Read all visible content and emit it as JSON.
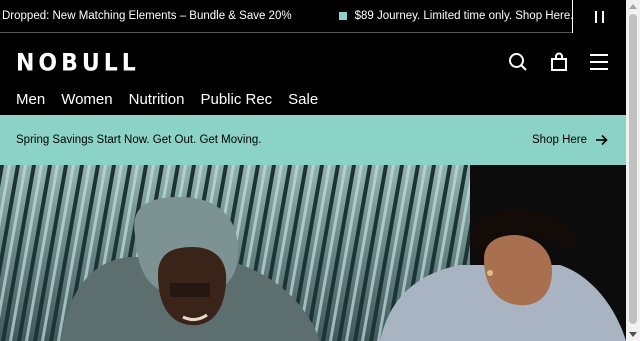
{
  "announcement": {
    "message_1": "Dropped: New Matching Elements – Bundle & Save 20%",
    "message_2": "$89 Journey. Limited time only. Shop Here.",
    "pause_icon": "pause-icon"
  },
  "header": {
    "logo": "NOBULL",
    "icons": [
      "search-icon",
      "bag-icon",
      "menu-icon"
    ],
    "nav": [
      "Men",
      "Women",
      "Nutrition",
      "Public Rec",
      "Sale"
    ]
  },
  "promo": {
    "text": "Spring Savings Start Now. Get Out. Get Moving.",
    "cta": "Shop Here",
    "cta_icon": "arrow-right-icon",
    "color": "#8bd3c7"
  },
  "hero": {
    "image": "two people in hoodies in front of corrugated metal wall"
  }
}
